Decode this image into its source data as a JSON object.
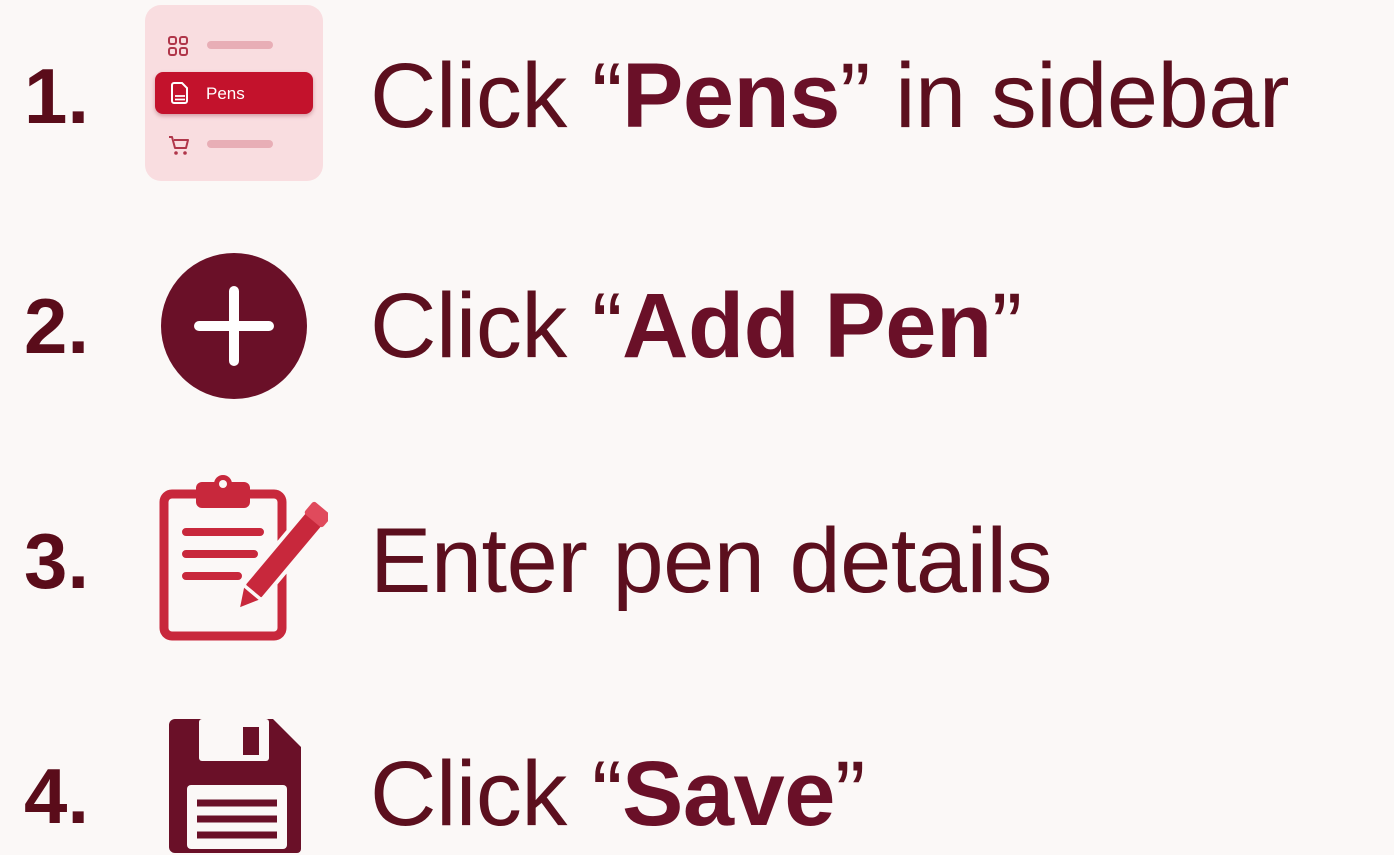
{
  "steps": [
    {
      "number": "1.",
      "prefix": "Click “",
      "bold": "Pens",
      "suffix": "” in sidebar",
      "icon": "sidebar-card-icon",
      "card": {
        "active_label": "Pens",
        "items": [
          "grid-icon",
          "pen-doc-icon",
          "cart-icon"
        ]
      }
    },
    {
      "number": "2.",
      "prefix": "Click “",
      "bold": "Add Pen",
      "suffix": "”",
      "icon": "plus-circle-icon"
    },
    {
      "number": "3.",
      "prefix": "Enter pen details",
      "bold": "",
      "suffix": "",
      "icon": "clipboard-pencil-icon"
    },
    {
      "number": "4.",
      "prefix": "Click “",
      "bold": "Save",
      "suffix": "”",
      "icon": "floppy-disk-icon"
    }
  ],
  "colors": {
    "primary_dark": "#5c0f1e",
    "accent_red": "#c3122c",
    "card_bg": "#f9dde0",
    "background": "#fbf8f7"
  }
}
